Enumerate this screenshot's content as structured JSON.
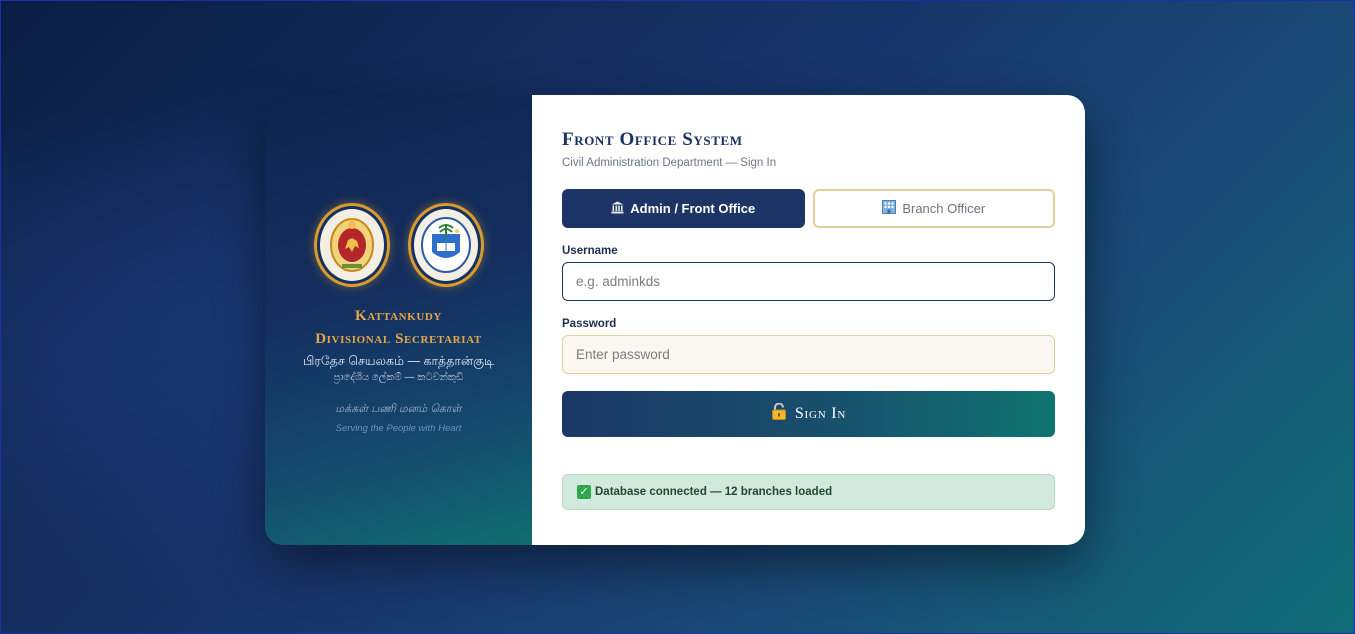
{
  "left_panel": {
    "org_line1": "Kattankudy",
    "org_line2": "Divisional Secretariat",
    "tamil_name": "பிரதேச செயலகம் — காத்தான்குடி",
    "sinhala_name": "ප්‍රාදේශීය ලේකම් — කටවන්කුඩි",
    "motto_tamil": "மக்கள் பணி மனம் கொள்",
    "motto_english": "Serving the People with Heart"
  },
  "form": {
    "title": "Front Office System",
    "subtitle": "Civil Administration Department — Sign In",
    "tabs": [
      {
        "label": "Admin / Front Office",
        "icon": "bank-icon",
        "active": true
      },
      {
        "label": "Branch Officer",
        "icon": "office-building-icon",
        "active": false
      }
    ],
    "username_label": "Username",
    "username_placeholder": "e.g. adminkds",
    "password_label": "Password",
    "password_placeholder": "Enter password",
    "signin_label": "Sign In",
    "status_text": "Database connected — 12 branches loaded"
  },
  "colors": {
    "primary_navy": "#1c3566",
    "accent_gold": "#e7a746",
    "teal": "#0f7470",
    "status_bg": "#d4e9de"
  }
}
